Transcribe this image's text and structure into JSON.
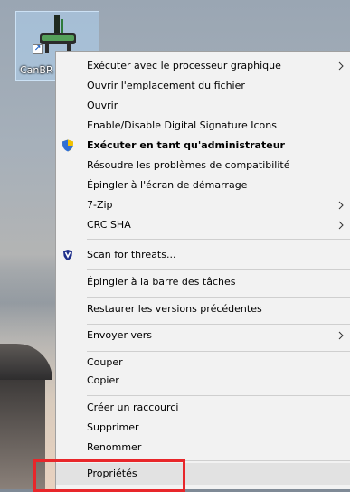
{
  "desktop": {
    "icon_label": "CanBR"
  },
  "context_menu": {
    "items": [
      {
        "label": "Exécuter avec le processeur graphique",
        "has_submenu": true
      },
      {
        "label": "Ouvrir l'emplacement du fichier"
      },
      {
        "label": "Ouvrir"
      },
      {
        "label": "Enable/Disable Digital Signature Icons"
      },
      {
        "label": "Exécuter en tant qu'administrateur",
        "icon": "uac-shield-icon",
        "bold": true
      },
      {
        "label": "Résoudre les problèmes de compatibilité"
      },
      {
        "label": "Épingler à l'écran de démarrage"
      },
      {
        "label": "7-Zip",
        "has_submenu": true
      },
      {
        "label": "CRC SHA",
        "has_submenu": true
      },
      {
        "label": "Scan for threats...",
        "icon": "antivirus-shield-icon"
      },
      {
        "label": "Épingler à la barre des tâches"
      },
      {
        "label": "Restaurer les versions précédentes"
      },
      {
        "label": "Envoyer vers",
        "has_submenu": true
      },
      {
        "label": "Couper"
      },
      {
        "label": "Copier"
      },
      {
        "label": "Créer un raccourci"
      },
      {
        "label": "Supprimer"
      },
      {
        "label": "Renommer"
      },
      {
        "label": "Propriétés",
        "highlighted": true
      }
    ]
  },
  "colors": {
    "menu_background": "#f2f2f2",
    "separator": "#cfcfcf",
    "highlight_box": "#e8262a",
    "selection_bg": "#e2e2e2"
  }
}
